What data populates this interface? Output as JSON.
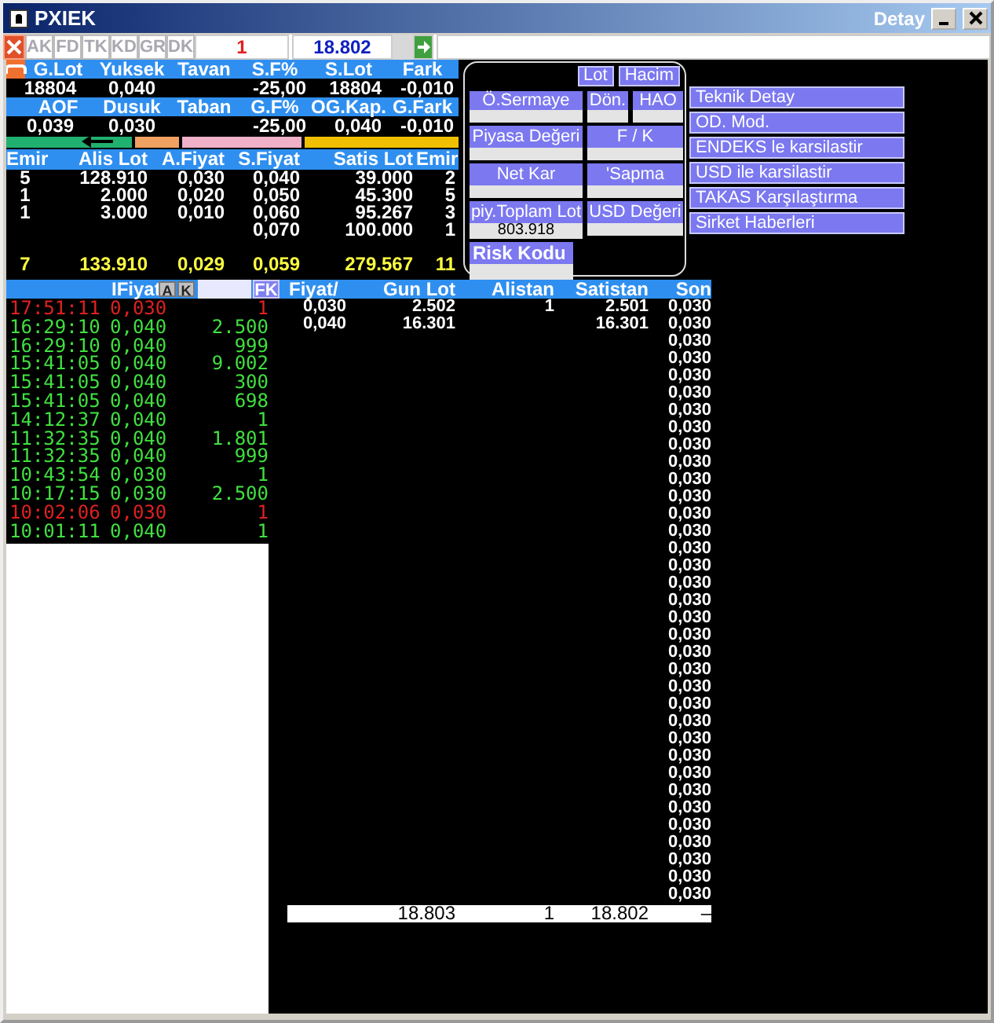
{
  "window": {
    "title": "PXIEK",
    "detail_title": "Detay"
  },
  "toolbar": {
    "tabs": [
      {
        "label": "AK",
        "disabled": true
      },
      {
        "label": "FD",
        "disabled": true
      },
      {
        "label": "TK",
        "disabled": true
      },
      {
        "label": "KD",
        "disabled": true
      },
      {
        "label": "GR",
        "disabled": true
      },
      {
        "label": "DK",
        "disabled": true
      }
    ],
    "lot_field": "1",
    "price_field": "18.802"
  },
  "stats": [
    [
      {
        "header": "G.Lot",
        "value": "18804"
      },
      {
        "header": "Yuksek",
        "value": "0,040"
      },
      {
        "header": "Tavan"
      },
      {
        "header": "S.F%",
        "value": "-25,00"
      },
      {
        "header": "S.Lot",
        "value": "18804"
      },
      {
        "header": "Fark",
        "value": "-0,010"
      }
    ],
    [
      {
        "header": "AOF",
        "value": "0,039"
      },
      {
        "header": "Dusuk",
        "value": "0,030"
      },
      {
        "header": "Taban"
      },
      {
        "header": "G.F%",
        "value": "-25,00"
      },
      {
        "header": "OG.Kap.",
        "value": "0,040"
      },
      {
        "header": "G.Fark",
        "value": "-0,010"
      }
    ]
  ],
  "order_book": {
    "columns": [
      "Emir",
      "Alis Lot",
      "A.Fiyat",
      "S.Fiyat",
      "Satis Lot",
      "Emir"
    ],
    "rows": [
      [
        "5",
        "128.910",
        "0,030",
        "0,040",
        "39.000",
        "2"
      ],
      [
        "1",
        "2.000",
        "0,020",
        "0,050",
        "45.300",
        "5"
      ],
      [
        "1",
        "3.000",
        "0,010",
        "0,060",
        "95.267",
        "3"
      ],
      [
        null,
        null,
        null,
        "0,070",
        "100.000",
        "1"
      ]
    ],
    "totals": [
      "7",
      "133.910",
      "0,029",
      "0,059",
      "279.567",
      "11"
    ]
  },
  "detail_panel": {
    "buttons": [
      "Lot",
      "Hacim"
    ],
    "fields": [
      {
        "label": "Ö.Sermaye"
      },
      {
        "label": "Dön."
      },
      {
        "label": "HAO"
      },
      {
        "label": "Piyasa Değeri"
      },
      {
        "label": "F / K"
      },
      {
        "label": "Net Kar"
      },
      {
        "label": "'Sapma"
      },
      {
        "label": "piy.Toplam Lot",
        "value": "803.918"
      },
      {
        "label": "USD Değeri"
      }
    ],
    "risk_label": "Risk Kodu"
  },
  "menu": [
    "Teknik Detay",
    "OD. Mod.",
    "ENDEKS le karsilastir",
    "USD ile karsilastir",
    "TAKAS Karşılaştırma",
    "Sirket Haberleri"
  ],
  "trades": {
    "header": "IFiyat",
    "toggles": [
      "A",
      "K"
    ],
    "filter": "FK",
    "rows": [
      {
        "time": "17:51:11",
        "price": "0,030",
        "lot": "1",
        "color": "#e02020"
      },
      {
        "time": "16:29:10",
        "price": "0,040",
        "lot": "2.500",
        "color": "#40e040"
      },
      {
        "time": "16:29:10",
        "price": "0,040",
        "lot": "999",
        "color": "#40e040"
      },
      {
        "time": "15:41:05",
        "price": "0,040",
        "lot": "9.002",
        "color": "#40e040"
      },
      {
        "time": "15:41:05",
        "price": "0,040",
        "lot": "300",
        "color": "#40e040"
      },
      {
        "time": "15:41:05",
        "price": "0,040",
        "lot": "698",
        "color": "#40e040"
      },
      {
        "time": "14:12:37",
        "price": "0,040",
        "lot": "1",
        "color": "#40e040"
      },
      {
        "time": "11:32:35",
        "price": "0,040",
        "lot": "1.801",
        "color": "#40e040"
      },
      {
        "time": "11:32:35",
        "price": "0,040",
        "lot": "999",
        "color": "#40e040"
      },
      {
        "time": "10:43:54",
        "price": "0,030",
        "lot": "1",
        "color": "#40e040"
      },
      {
        "time": "10:17:15",
        "price": "0,030",
        "lot": "2.500",
        "color": "#40e040"
      },
      {
        "time": "10:02:06",
        "price": "0,030",
        "lot": "1",
        "color": "#e02020"
      },
      {
        "time": "10:01:11",
        "price": "0,040",
        "lot": "1",
        "color": "#40e040"
      }
    ]
  },
  "price_table": {
    "columns": [
      "Fiyat/",
      "Gun Lot",
      "Alistan",
      "Satistan",
      "Son"
    ],
    "rows": [
      {
        "price": "0,030",
        "day_lot": "2.502",
        "bid": "1",
        "ask": "2.501"
      },
      {
        "price": "0,040",
        "day_lot": "16.301",
        "ask": "16.301"
      }
    ],
    "son": [
      "0,030",
      "0,030",
      "0,030",
      "0,030",
      "0,030",
      "0,030",
      "0,030",
      "0,030",
      "0,030",
      "0,030",
      "0,030",
      "0,030",
      "0,030",
      "0,030",
      "0,030",
      "0,030",
      "0,030",
      "0,030",
      "0,030",
      "0,030",
      "0,030",
      "0,030",
      "0,030",
      "0,030",
      "0,030",
      "0,030",
      "0,030",
      "0,030",
      "0,030",
      "0,030",
      "0,030",
      "0,030",
      "0,030",
      "0,030",
      "0,030"
    ],
    "totals": {
      "day_lot": "18.803",
      "bid": "1",
      "ask": "18.802",
      "last": "–"
    }
  }
}
